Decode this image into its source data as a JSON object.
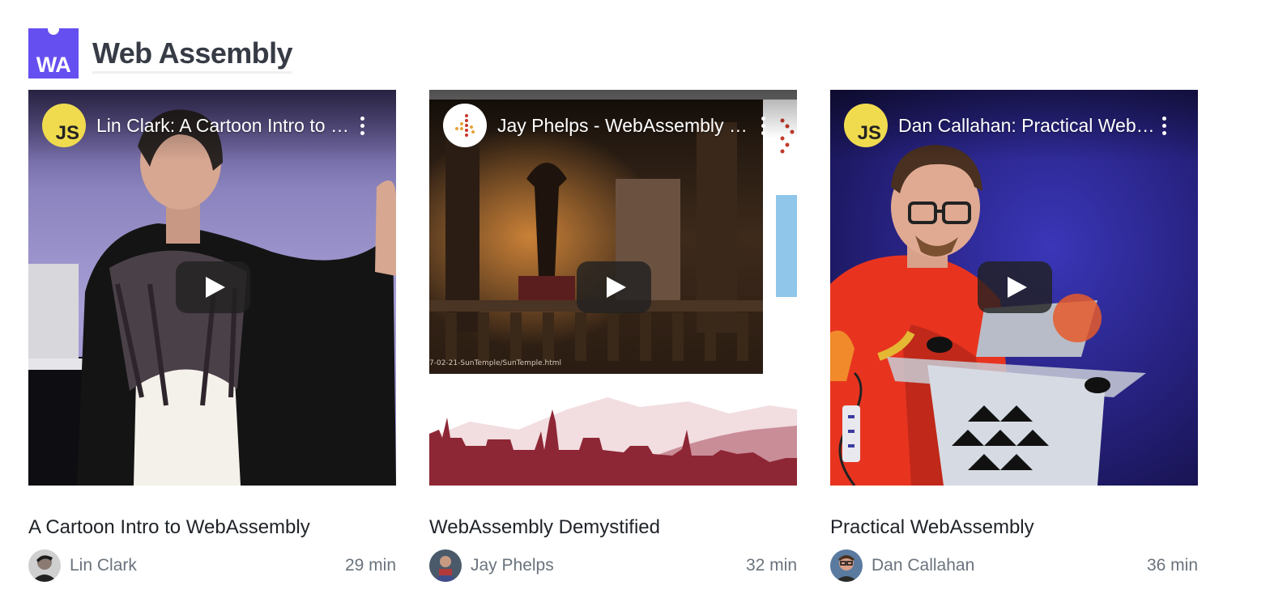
{
  "section": {
    "logo_text": "WA",
    "title": "Web Assembly",
    "brand_color": "#654ff0"
  },
  "videos": [
    {
      "video_title": "Lin Clark: A Cartoon Intro to WebAssembly",
      "channel_icon_text": "JS",
      "channel_icon": "js-channel-logo",
      "talk_title": "A Cartoon Intro to WebAssembly",
      "author": "Lin Clark",
      "duration": "29 min"
    },
    {
      "video_title": "Jay Phelps - WebAssembly Demystified",
      "channel_icon": "dotted-logo",
      "slide_url": "7-02-21-SunTemple/SunTemple.html",
      "talk_title": "WebAssembly Demystified",
      "author": "Jay Phelps",
      "duration": "32 min"
    },
    {
      "video_title": "Dan Callahan: Practical WebAssembly",
      "channel_icon_text": "JS",
      "channel_icon": "js-channel-logo",
      "talk_title": "Practical WebAssembly",
      "author": "Dan Callahan",
      "duration": "36 min"
    }
  ],
  "player": {
    "play_icon": "play-icon",
    "menu_icon": "more-vertical-icon"
  }
}
